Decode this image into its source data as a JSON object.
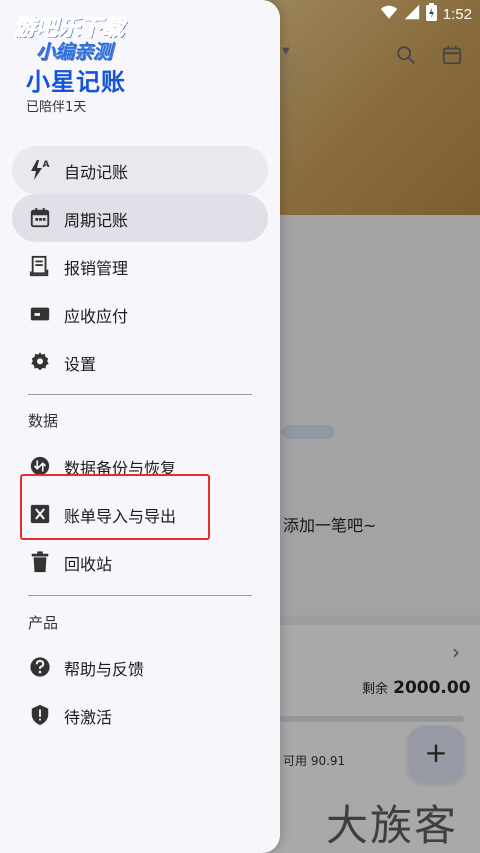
{
  "status_bar": {
    "time": "1:52"
  },
  "background": {
    "empty_text": "添加一笔吧~",
    "remaining_label": "剩余",
    "remaining_value": "2000.00",
    "available_text": "可用 90.91",
    "fab_label": "+"
  },
  "watermark": {
    "line1": "游吧乐下载",
    "line2": "小编亲测",
    "bottom": "大族客"
  },
  "drawer": {
    "app_name": "小星记账",
    "companion": "已陪伴1天",
    "items": [
      {
        "label": "自动记账",
        "icon": "auto-bookkeeping-icon"
      },
      {
        "label": "周期记账",
        "icon": "calendar-icon"
      },
      {
        "label": "报销管理",
        "icon": "receipt-icon"
      },
      {
        "label": "应收应付",
        "icon": "card-icon"
      },
      {
        "label": "设置",
        "icon": "gear-icon"
      }
    ],
    "section_data": "数据",
    "data_items": [
      {
        "label": "数据备份与恢复",
        "icon": "backup-restore-icon"
      },
      {
        "label": "账单导入与导出",
        "icon": "excel-icon"
      },
      {
        "label": "回收站",
        "icon": "trash-icon"
      }
    ],
    "section_product": "产品",
    "product_items": [
      {
        "label": "帮助与反馈",
        "icon": "help-icon"
      },
      {
        "label": "待激活",
        "icon": "shield-icon"
      }
    ]
  },
  "colors": {
    "brand": "#1554d6",
    "highlight_border": "#e52e2e"
  }
}
